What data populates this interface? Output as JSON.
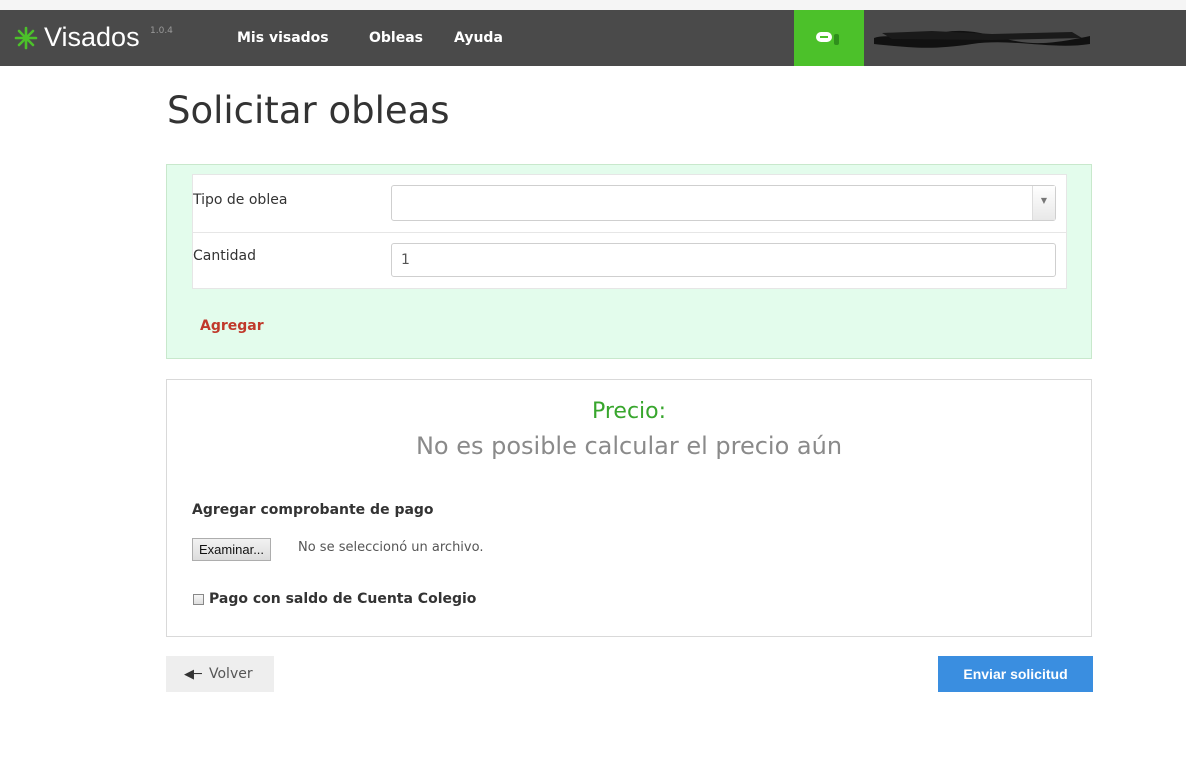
{
  "app": {
    "brand_name": "Visados",
    "version": "1.0.4",
    "brand_icon": "asterisk-icon",
    "brand_color": "#4cc12a"
  },
  "nav": {
    "items": [
      {
        "label": "Mis visados"
      },
      {
        "label": "Obleas"
      },
      {
        "label": "Ayuda"
      }
    ]
  },
  "user": {
    "icon": "user-badge-icon",
    "name_redacted": true
  },
  "page": {
    "title": "Solicitar obleas"
  },
  "form": {
    "tipo_label": "Tipo de oblea",
    "tipo_value": "",
    "cantidad_label": "Cantidad",
    "cantidad_value": "1",
    "agregar_label": "Agregar"
  },
  "precio": {
    "title": "Precio:",
    "message": "No es posible calcular el precio aún"
  },
  "comprobante": {
    "label": "Agregar comprobante de pago",
    "button_label": "Examinar...",
    "file_status": "No se seleccionó un archivo."
  },
  "saldo": {
    "label": "Pago con saldo de Cuenta Colegio",
    "checked": false
  },
  "actions": {
    "volver_label": "Volver",
    "enviar_label": "Enviar solicitud"
  },
  "colors": {
    "navbar": "#4a4a4a",
    "panel_green": "#e3fcec",
    "link_red": "#c0392b",
    "precio_green": "#38a62d",
    "primary_button": "#3a8ee0"
  }
}
